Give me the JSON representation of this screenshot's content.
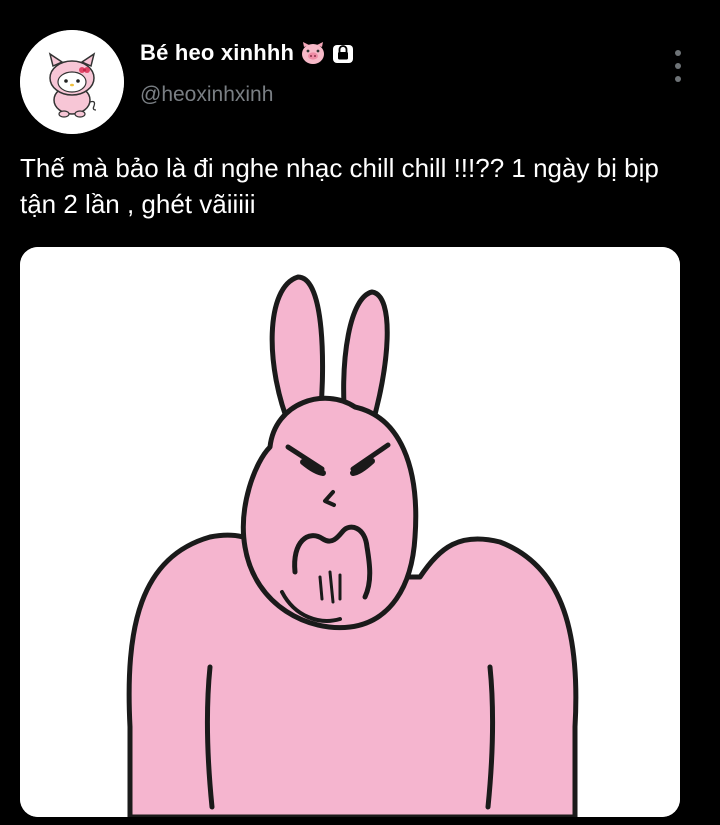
{
  "tweet": {
    "display_name": "Bé heo xinhhh",
    "name_emoji_icon": "pig-face-icon",
    "protected_icon": "lock-icon",
    "handle": "@heoxinhxinh",
    "more_icon": "more-vertical-icon",
    "text": "Thế mà bảo là đi nghe nhạc chill chill !!!?? 1 ngày bị bịp tận 2 lần , ghét vãiiiii",
    "media": {
      "type": "image",
      "description_icon": "angry-pink-rabbit-illustration"
    }
  },
  "colors": {
    "background": "#000000",
    "text_primary": "#ffffff",
    "text_secondary": "#7a7f84",
    "media_background": "#ffffff",
    "rabbit_pink": "#f5b5cf"
  }
}
